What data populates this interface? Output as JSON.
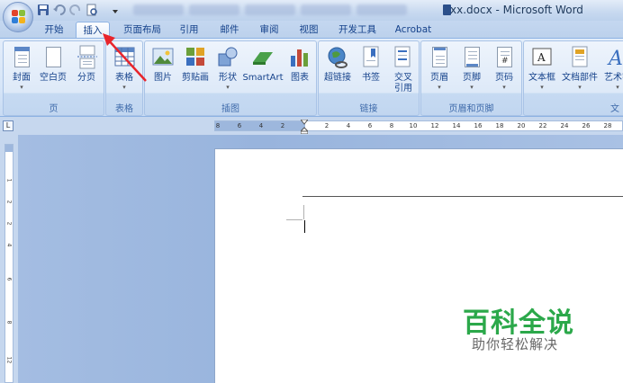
{
  "window": {
    "title": "xx.docx - Microsoft Word"
  },
  "tabs": [
    {
      "label": "开始"
    },
    {
      "label": "插入"
    },
    {
      "label": "页面布局"
    },
    {
      "label": "引用"
    },
    {
      "label": "邮件"
    },
    {
      "label": "审阅"
    },
    {
      "label": "视图"
    },
    {
      "label": "开发工具"
    },
    {
      "label": "Acrobat"
    }
  ],
  "active_tab": "插入",
  "ribbon": {
    "groups": {
      "pages": {
        "label": "页",
        "buttons": [
          {
            "label": "封面"
          },
          {
            "label": "空白页"
          },
          {
            "label": "分页"
          }
        ]
      },
      "tables": {
        "label": "表格",
        "buttons": [
          {
            "label": "表格"
          }
        ]
      },
      "illustrations": {
        "label": "插图",
        "buttons": [
          {
            "label": "图片"
          },
          {
            "label": "剪贴画"
          },
          {
            "label": "形状"
          },
          {
            "label": "SmartArt"
          },
          {
            "label": "图表"
          }
        ]
      },
      "links": {
        "label": "链接",
        "buttons": [
          {
            "label": "超链接"
          },
          {
            "label": "书签"
          },
          {
            "label": "交叉引用",
            "line1": "交叉",
            "line2": "引用"
          }
        ]
      },
      "header_footer": {
        "label": "页眉和页脚",
        "buttons": [
          {
            "label": "页眉"
          },
          {
            "label": "页脚"
          },
          {
            "label": "页码"
          }
        ]
      },
      "text": {
        "label": "文",
        "buttons": [
          {
            "label": "文本框"
          },
          {
            "label": "文档部件"
          },
          {
            "label": "艺术字"
          }
        ]
      }
    }
  },
  "ruler": {
    "left_numbers": [
      "8",
      "6",
      "4",
      "2"
    ],
    "right_numbers": [
      "2",
      "4",
      "6",
      "8",
      "10",
      "12",
      "14",
      "16",
      "18",
      "20",
      "22",
      "24",
      "26",
      "28"
    ],
    "corner_label": "L",
    "vertical_numbers": [
      "1",
      "2",
      "4",
      "6",
      "8",
      "10",
      "12"
    ]
  },
  "watermark": {
    "title": "百科全说",
    "subtitle": "助你轻松解决"
  },
  "colors": {
    "accent": "#15428b",
    "annotation_arrow": "#e8242b",
    "watermark_green": "#2ba84a"
  }
}
